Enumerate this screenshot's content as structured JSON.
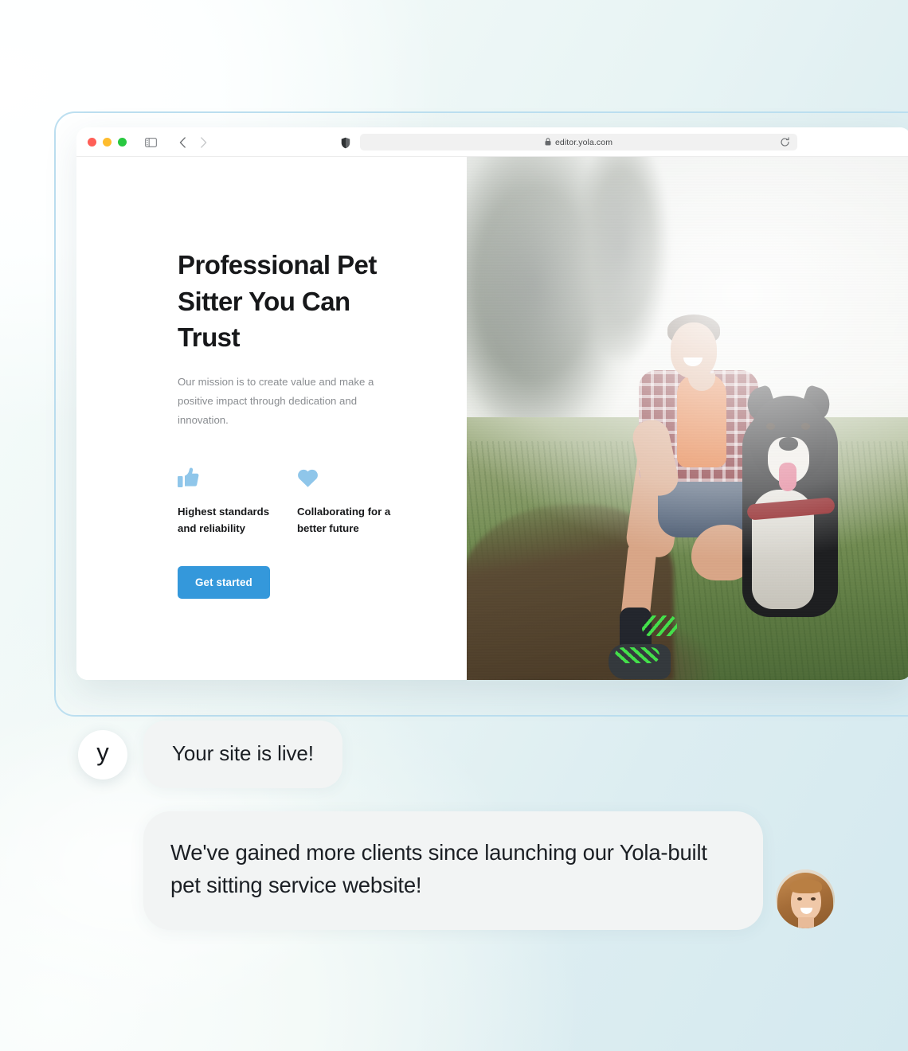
{
  "browser": {
    "traffic_lights": [
      "close",
      "minimize",
      "maximize"
    ],
    "sidebar_icon": "sidebar-toggle-icon",
    "back_icon": "chevron-left-icon",
    "forward_icon": "chevron-right-icon",
    "shield_icon": "shield-privacy-icon",
    "lock_icon": "lock-icon",
    "url": "editor.yola.com",
    "reload_icon": "reload-icon"
  },
  "site": {
    "headline": "Professional Pet Sitter You Can Trust",
    "subcopy": "Our mission is to create value and make a positive impact through dedication and innovation.",
    "features": [
      {
        "icon": "thumbs-up-icon",
        "label": "Highest standards and reliability"
      },
      {
        "icon": "heart-icon",
        "label": "Collaborating for a better future"
      }
    ],
    "cta_label": "Get started",
    "hero_image_alt": "Man crouching on a grassy path with a black and white border collie in foggy field"
  },
  "chat": {
    "brand_initial": "y",
    "message_1": "Your site is live!",
    "message_2": "We've gained more clients since launching our Yola-built pet sitting service website!",
    "reviewer_alt": "Smiling woman with long light-brown hair"
  },
  "colors": {
    "accent_blue": "#3498db",
    "feature_icon_blue": "#8fc6ea",
    "bubble_gray": "#f2f4f4",
    "text_dark": "#17181a",
    "text_muted": "#8a8d91",
    "frame_blue": "#bcdff0",
    "bg_right": "#d4e9ef"
  }
}
